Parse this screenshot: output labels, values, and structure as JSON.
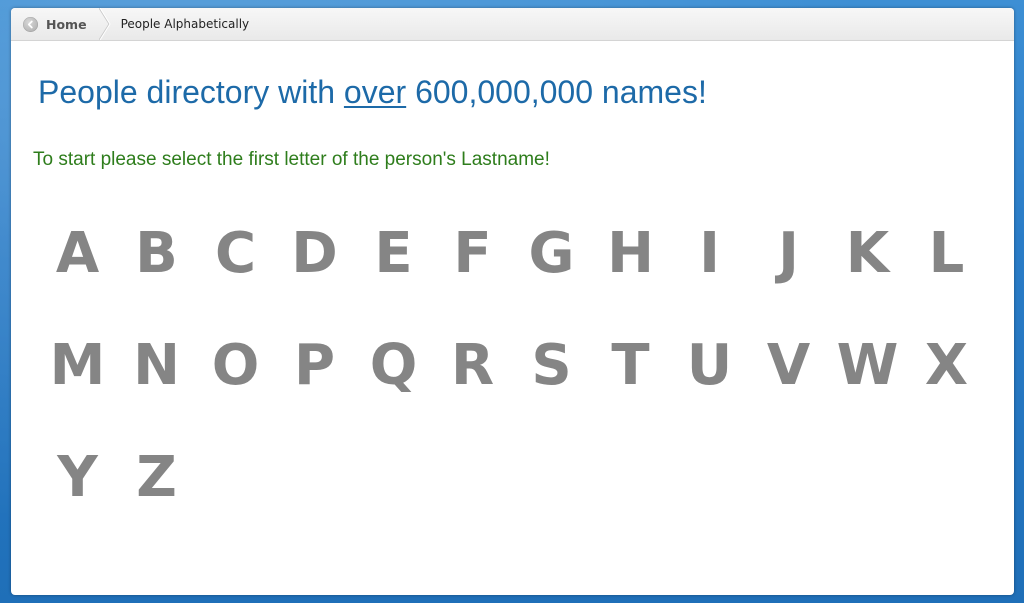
{
  "breadcrumb": {
    "home_label": "Home",
    "current_label": "People Alphabetically"
  },
  "headline": {
    "prefix": "People directory with ",
    "emphasis": "over",
    "suffix": " 600,000,000 names!"
  },
  "instruction": "To start please select the first letter of the person's Lastname!",
  "letters": [
    "A",
    "B",
    "C",
    "D",
    "E",
    "F",
    "G",
    "H",
    "I",
    "J",
    "K",
    "L",
    "M",
    "N",
    "O",
    "P",
    "Q",
    "R",
    "S",
    "T",
    "U",
    "V",
    "W",
    "X",
    "Y",
    "Z"
  ],
  "colors": {
    "headline": "#1d6aa8",
    "instruction": "#2e7d1c",
    "letter": "#858585",
    "background": "#2a7cc7"
  },
  "icons": {
    "home": "back-arrow-circle-icon"
  }
}
